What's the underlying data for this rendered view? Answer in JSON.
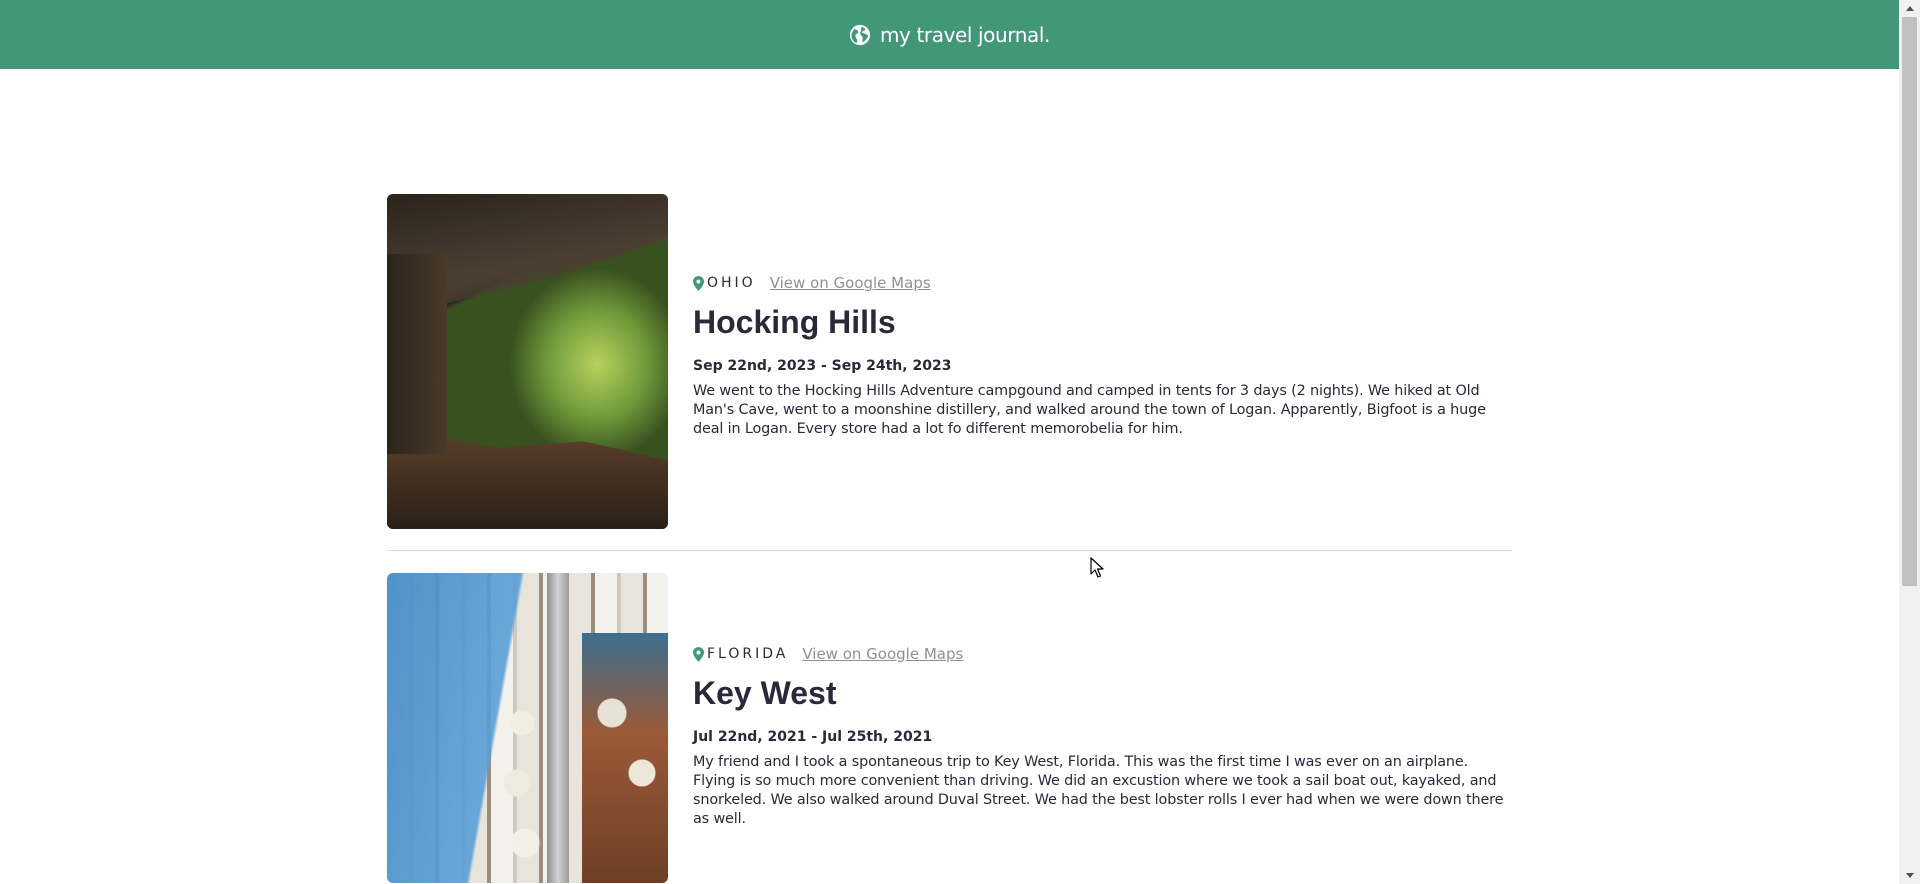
{
  "header": {
    "title": "my travel journal.",
    "icon": "globe-icon"
  },
  "colors": {
    "brand": "#429778",
    "pin": "#429778",
    "text": "#2b283a",
    "link": "#918e9b"
  },
  "entries": [
    {
      "location": "OHIO",
      "maps_link": "View on Google Maps",
      "title": "Hocking Hills",
      "dates": "Sep 22nd, 2023 - Sep 24th, 2023",
      "description": "We went to the Hocking Hills Adventure campgound and camped in tents for 3 days (2 nights). We hiked at Old Man's Cave, went to a moonshine distillery, and walked around the town of Logan. Apparently, Bigfoot is a huge deal in Logan. Every store had a lot fo different memorobelia for him."
    },
    {
      "location": "FLORIDA",
      "maps_link": "View on Google Maps",
      "title": "Key West",
      "dates": "Jul 22nd, 2021 - Jul 25th, 2021",
      "description": "My friend and I took a spontaneous trip to Key West, Florida. This was the first time I was ever on an airplane. Flying is so much more convenient than driving. We did an excustion where we took a sail boat out, kayaked, and snorkeled. We also walked around Duval Street. We had the best lobster rolls I ever had when we were down there as well."
    }
  ]
}
